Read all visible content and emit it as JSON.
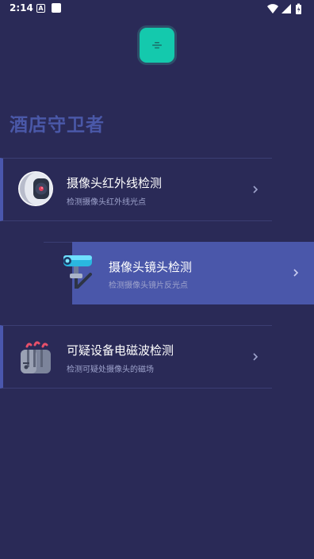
{
  "status_bar": {
    "time": "2:14",
    "notification_letter": "A"
  },
  "app": {
    "title": "酒店守卫者",
    "accent_color": "#14c9ad",
    "primary_color": "#4a57aa",
    "background_color": "#2a2a57"
  },
  "menu_button": {
    "icon": "menu-icon"
  },
  "cards": [
    {
      "title": "摄像头红外线检测",
      "subtitle": "检测摄像头红外线光点",
      "icon": "camera-lens-icon",
      "selected": false
    },
    {
      "title": "摄像头镜头检测",
      "subtitle": "检测摄像头镜片反光点",
      "icon": "surveillance-camera-icon",
      "selected": true
    },
    {
      "title": "可疑设备电磁波检测",
      "subtitle": "检测可疑处摄像头的磁场",
      "icon": "toaster-device-icon",
      "selected": false
    }
  ]
}
